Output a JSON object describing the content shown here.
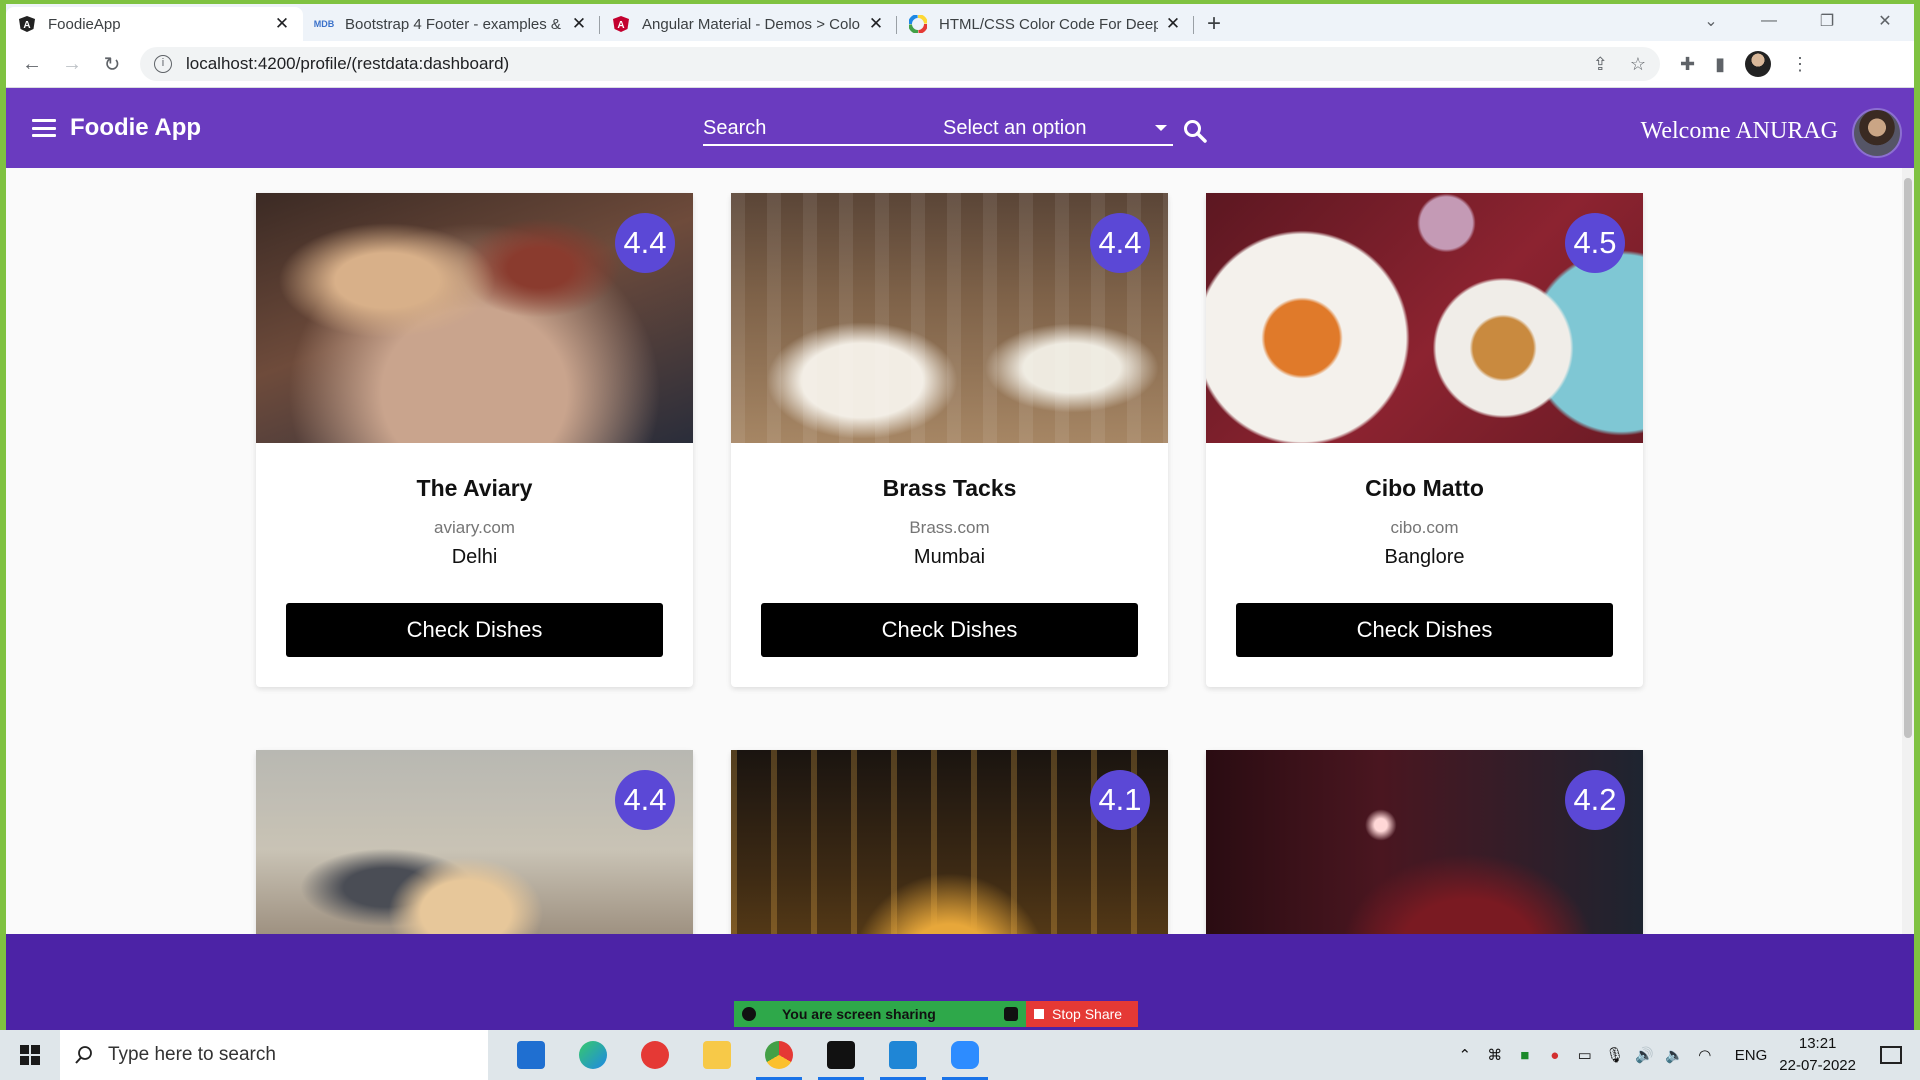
{
  "browser": {
    "tabs": [
      {
        "title": "FoodieApp",
        "active": true,
        "favicon": "angular-icon"
      },
      {
        "title": "Bootstrap 4 Footer - examples &",
        "active": false,
        "favicon": "mdb-icon"
      },
      {
        "title": "Angular Material - Demos > Colo",
        "active": false,
        "favicon": "angular-red-icon"
      },
      {
        "title": "HTML/CSS Color Code For Deep",
        "active": false,
        "favicon": "color-wheel-icon"
      }
    ],
    "url": "localhost:4200/profile/(restdata:dashboard)"
  },
  "app": {
    "brand": "Foodie App",
    "search_label": "Search",
    "select_value": "Select an option",
    "welcome": "Welcome ANURAG",
    "header_color": "#6a3bbf"
  },
  "restaurants": [
    {
      "name": "The Aviary",
      "site": "aviary.com",
      "city": "Delhi",
      "rating": "4.4",
      "button": "Check Dishes"
    },
    {
      "name": "Brass Tacks",
      "site": "Brass.com",
      "city": "Mumbai",
      "rating": "4.4",
      "button": "Check Dishes"
    },
    {
      "name": "Cibo Matto",
      "site": "cibo.com",
      "city": "Banglore",
      "rating": "4.5",
      "button": "Check Dishes"
    },
    {
      "rating": "4.4"
    },
    {
      "rating": "4.1"
    },
    {
      "rating": "4.2"
    }
  ],
  "screen_share": {
    "status": "You are screen sharing",
    "stop": "Stop Share"
  },
  "taskbar": {
    "search_placeholder": "Type here to search",
    "lang": "ENG",
    "time": "13:21",
    "date": "22-07-2022"
  }
}
